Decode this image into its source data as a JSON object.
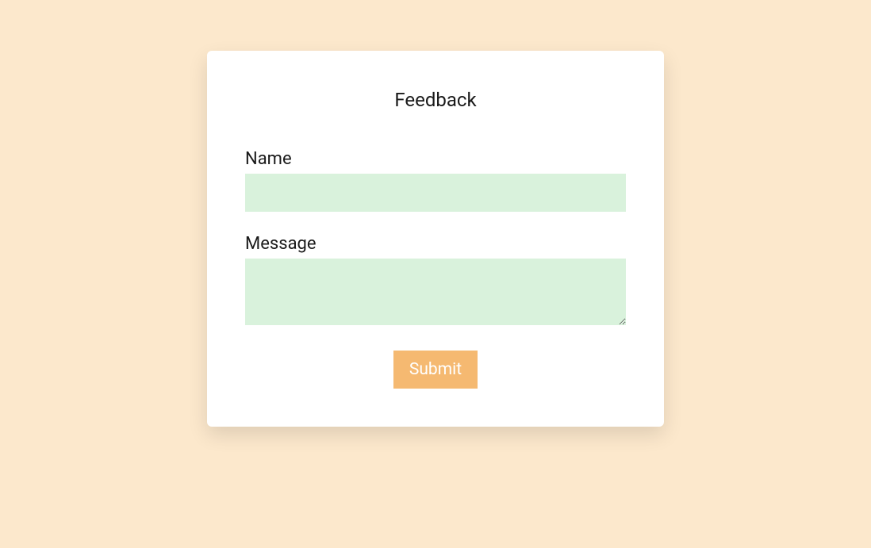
{
  "form": {
    "title": "Feedback",
    "name_label": "Name",
    "name_value": "",
    "message_label": "Message",
    "message_value": "",
    "submit_label": "Submit"
  },
  "colors": {
    "background": "#fce8cc",
    "card": "#ffffff",
    "input_bg": "#d9f2dc",
    "button_bg": "#f5b971",
    "button_text": "#ffffff"
  }
}
